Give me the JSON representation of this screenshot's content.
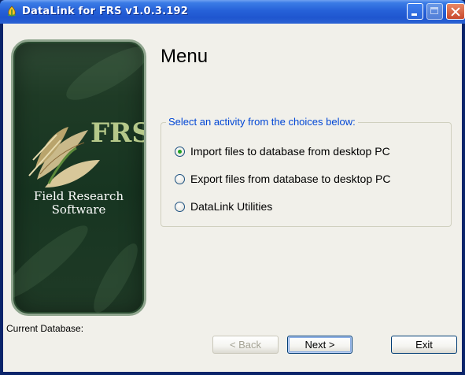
{
  "window": {
    "title": "DataLink for FRS v1.0.3.192",
    "icons": [
      "app-icon",
      "minimize-icon",
      "maximize-icon",
      "close-icon"
    ]
  },
  "logo": {
    "letters": "FRS",
    "line1": "Field Research",
    "line2": "Software"
  },
  "main": {
    "heading": "Menu",
    "group_label": "Select an activity from the choices below:",
    "options": [
      {
        "label": "Import files to database from desktop PC",
        "checked": true
      },
      {
        "label": "Export files from database to desktop PC",
        "checked": false
      },
      {
        "label": "DataLink Utilities",
        "checked": false
      }
    ]
  },
  "footer": {
    "current_db_label": "Current Database:",
    "back_label": "< Back",
    "next_label": "Next >",
    "exit_label": "Exit"
  },
  "colors": {
    "titlebar": "#2661d8",
    "client_bg": "#f1f0ea",
    "group_label": "#0046d5",
    "logo_bg": "#1f3b26"
  }
}
